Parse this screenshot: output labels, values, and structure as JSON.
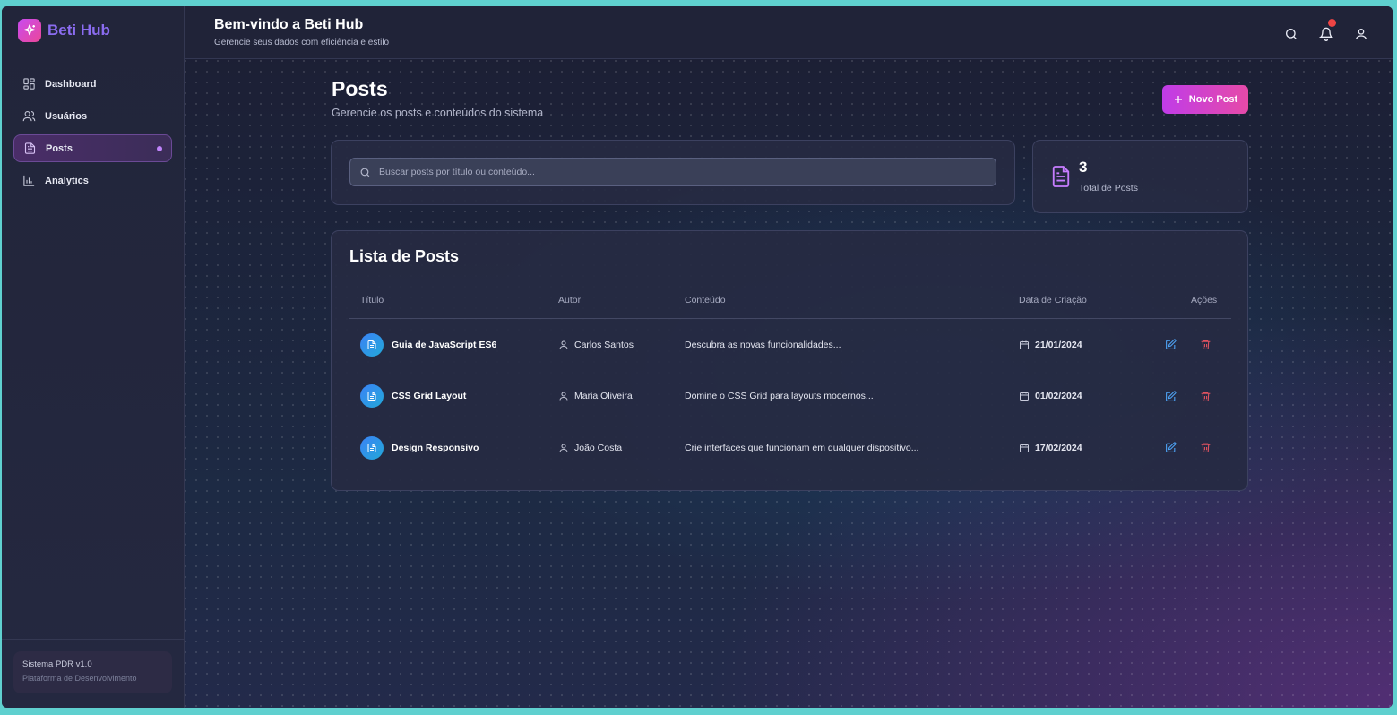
{
  "app": {
    "name": "Beti Hub"
  },
  "sidebar": {
    "items": [
      {
        "label": "Dashboard",
        "icon": "dashboard-icon"
      },
      {
        "label": "Usuários",
        "icon": "users-icon"
      },
      {
        "label": "Posts",
        "icon": "document-icon",
        "active": true
      },
      {
        "label": "Analytics",
        "icon": "bar-chart-icon"
      }
    ],
    "footer": {
      "version": "Sistema PDR v1.0",
      "subtitle": "Plataforma de Desenvolvimento"
    }
  },
  "header": {
    "title": "Bem-vindo a Beti Hub",
    "subtitle": "Gerencie seus dados com eficiência e estilo"
  },
  "page": {
    "title": "Posts",
    "subtitle": "Gerencie os posts e conteúdos do sistema",
    "new_button": "Novo Post"
  },
  "search": {
    "placeholder": "Buscar posts por título ou conteúdo..."
  },
  "stats": {
    "total": "3",
    "label": "Total de Posts"
  },
  "list": {
    "title": "Lista de Posts",
    "columns": [
      "Título",
      "Autor",
      "Conteúdo",
      "Data de Criação",
      "Ações"
    ],
    "rows": [
      {
        "title": "Guia de JavaScript ES6",
        "author": "Carlos Santos",
        "content": "Descubra as novas funcionalidades...",
        "date": "21/01/2024"
      },
      {
        "title": "CSS Grid Layout",
        "author": "Maria Oliveira",
        "content": "Domine o CSS Grid para layouts modernos...",
        "date": "01/02/2024"
      },
      {
        "title": "Design Responsivo",
        "author": "João Costa",
        "content": "Crie interfaces que funcionam em qualquer dispositivo...",
        "date": "17/02/2024"
      }
    ]
  },
  "colors": {
    "accent": "#c03ce8",
    "active_dot": "#c084fc",
    "notification": "#ef4444",
    "edit": "#4ea3f5",
    "delete": "#e05260"
  }
}
